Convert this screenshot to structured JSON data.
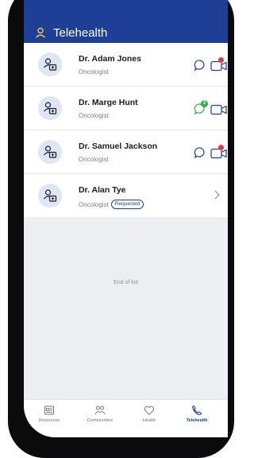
{
  "app": {
    "title": "Telehealth"
  },
  "colors": {
    "brand": "#1f3f97",
    "unread": "#2fae4a",
    "alert": "#e23b3b"
  },
  "doctors": [
    {
      "name": "Dr. Adam Jones",
      "specialty": "Oncologist",
      "actions": [
        "chat-icon",
        "video-icon"
      ],
      "alert": true
    },
    {
      "name": "Dr. Marge Hunt",
      "specialty": "Oncologist",
      "actions": [
        "chat-icon",
        "video-icon"
      ],
      "unread": "3"
    },
    {
      "name": "Dr. Samuel Jackson",
      "specialty": "Oncologist",
      "actions": [
        "chat-icon",
        "video-icon"
      ],
      "alert": true
    },
    {
      "name": "Dr. Alan Tye",
      "specialty": "Oncologist",
      "status": "Requested"
    }
  ],
  "end_of_list": "End of list",
  "tabs": [
    {
      "label": "Resources",
      "icon": "resources-icon"
    },
    {
      "label": "Communities",
      "icon": "communities-icon"
    },
    {
      "label": "Health",
      "icon": "heart-icon"
    },
    {
      "label": "Telehealth",
      "icon": "phone-icon",
      "active": true
    }
  ]
}
